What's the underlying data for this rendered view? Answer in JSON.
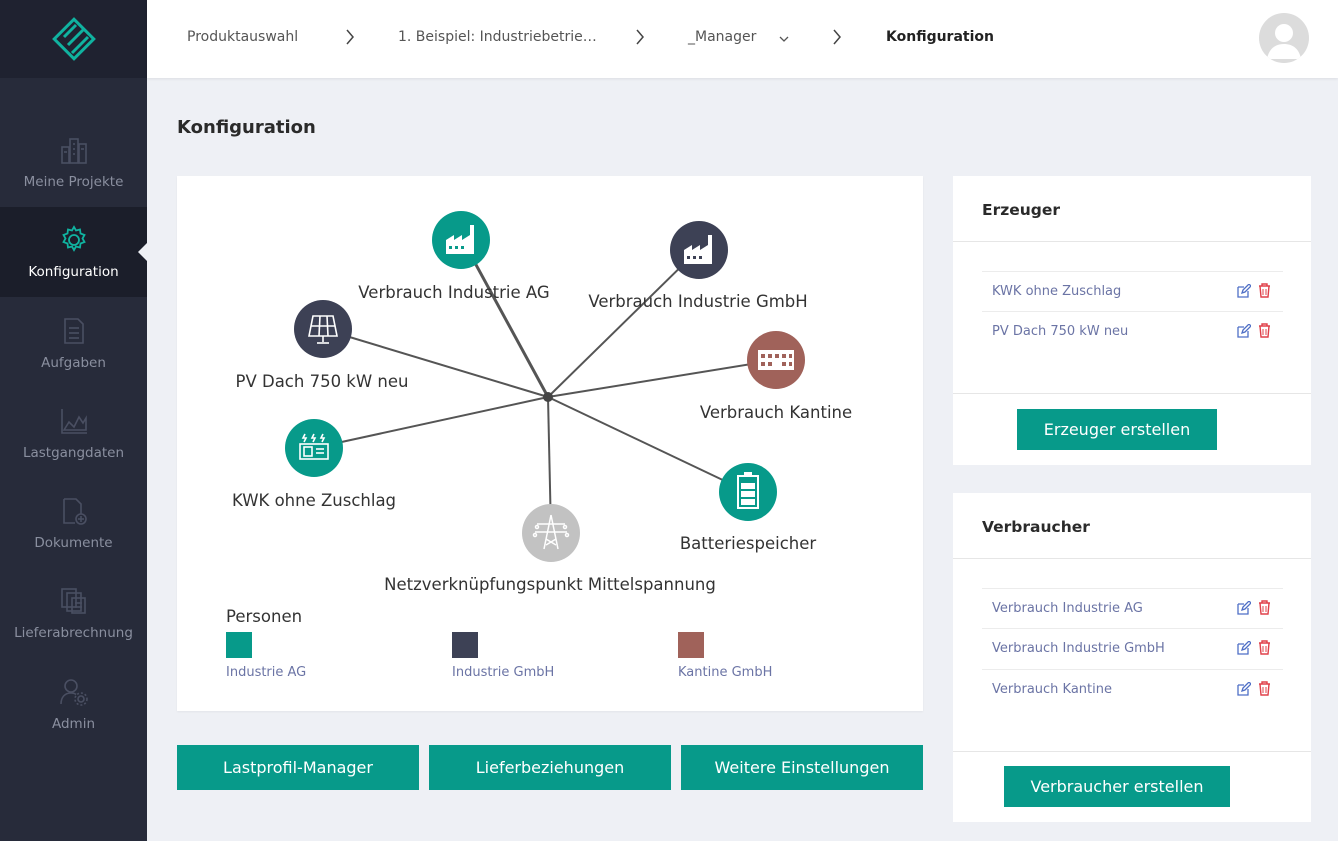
{
  "sidebar": {
    "items": [
      {
        "label": "Meine Projekte",
        "icon": "city-icon"
      },
      {
        "label": "Konfiguration",
        "icon": "gear-icon",
        "active": true
      },
      {
        "label": "Aufgaben",
        "icon": "task-list-icon"
      },
      {
        "label": "Lastgangdaten",
        "icon": "area-chart-icon"
      },
      {
        "label": "Dokumente",
        "icon": "document-add-icon"
      },
      {
        "label": "Lieferabrechnung",
        "icon": "invoice-stack-icon"
      },
      {
        "label": "Admin",
        "icon": "user-settings-icon"
      }
    ]
  },
  "header": {
    "breadcrumb": [
      "Produktauswahl",
      "1. Beispiel: Industriebetrie…",
      "_Manager",
      "Konfiguration"
    ]
  },
  "main": {
    "title": "Konfiguration",
    "diagram": {
      "nodes": [
        {
          "label": "Verbrauch Industrie AG",
          "icon": "factory-icon",
          "color": "#079a8a"
        },
        {
          "label": "Verbrauch Industrie GmbH",
          "icon": "factory-icon",
          "color": "#3d4155"
        },
        {
          "label": "PV Dach 750 kW neu",
          "icon": "solar-panel-icon",
          "color": "#3d4155"
        },
        {
          "label": "Verbrauch Kantine",
          "icon": "building-icon",
          "color": "#a0625a"
        },
        {
          "label": "KWK ohne Zuschlag",
          "icon": "chp-generator-icon",
          "color": "#079a8a"
        },
        {
          "label": "Batteriespeicher",
          "icon": "battery-icon",
          "color": "#079a8a"
        },
        {
          "label": "Netzverknüpfungspunkt Mittelspannung",
          "icon": "power-pylon-icon",
          "color": "#c2c2c2"
        }
      ],
      "legend": {
        "title": "Personen",
        "items": [
          {
            "label": "Industrie AG",
            "color": "#079a8a"
          },
          {
            "label": "Industrie GmbH",
            "color": "#3d4155"
          },
          {
            "label": "Kantine GmbH",
            "color": "#a0625a"
          }
        ]
      }
    },
    "actions": [
      "Lastprofil-Manager",
      "Lieferbeziehungen",
      "Weitere Einstellungen"
    ]
  },
  "erzeuger": {
    "title": "Erzeuger",
    "items": [
      "KWK ohne Zuschlag",
      "PV Dach 750 kW neu"
    ],
    "button": "Erzeuger erstellen"
  },
  "verbraucher": {
    "title": "Verbraucher",
    "items": [
      "Verbrauch Industrie AG",
      "Verbrauch Industrie GmbH",
      "Verbrauch Kantine"
    ],
    "button": "Verbraucher erstellen"
  },
  "colors": {
    "accent": "#079a8a",
    "sidebar": "#272b3a",
    "link": "#6b74a5",
    "danger": "#e0404a"
  }
}
